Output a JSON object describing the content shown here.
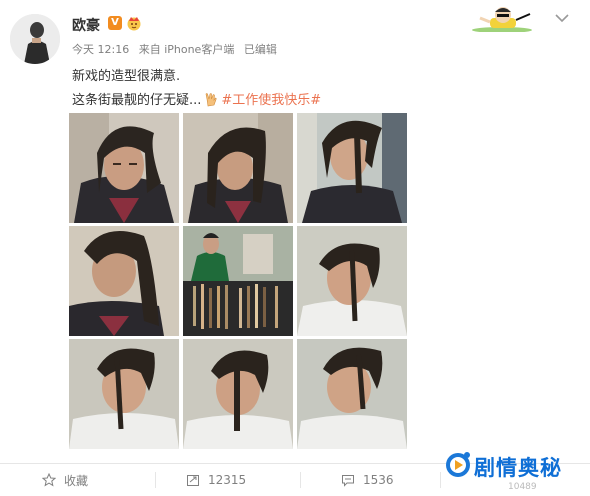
{
  "post": {
    "username": "欧豪",
    "verified_badge": "V",
    "time": "今天 12:16",
    "source": "来自 iPhone客户端",
    "edited": "已编辑",
    "text_line1": "新戏的造型很满意.",
    "text_line2_prefix": "这条街最靓的仔无疑...",
    "hashtag": "#工作使我快乐#"
  },
  "photos": [
    {
      "alt": "photo-1"
    },
    {
      "alt": "photo-2"
    },
    {
      "alt": "photo-3"
    },
    {
      "alt": "photo-4"
    },
    {
      "alt": "photo-5"
    },
    {
      "alt": "photo-6"
    },
    {
      "alt": "photo-7"
    },
    {
      "alt": "photo-8"
    },
    {
      "alt": "photo-9"
    }
  ],
  "actions": {
    "favorite_label": "收藏",
    "repost_count": "12315",
    "comment_count": "1536",
    "like_count": "10489"
  },
  "watermark": {
    "text": "剧情奥秘"
  },
  "colors": {
    "hashtag": "#eb7350",
    "verified": "#f28c20",
    "watermark": "#0f6fd6",
    "meta": "#808080"
  },
  "icons": [
    "avatar",
    "verified-icon",
    "crown-icon",
    "cartoon-sticker",
    "chevron-down-icon",
    "rock-hand-icon",
    "star-icon",
    "repost-icon",
    "comment-icon",
    "watermark-logo-icon"
  ]
}
